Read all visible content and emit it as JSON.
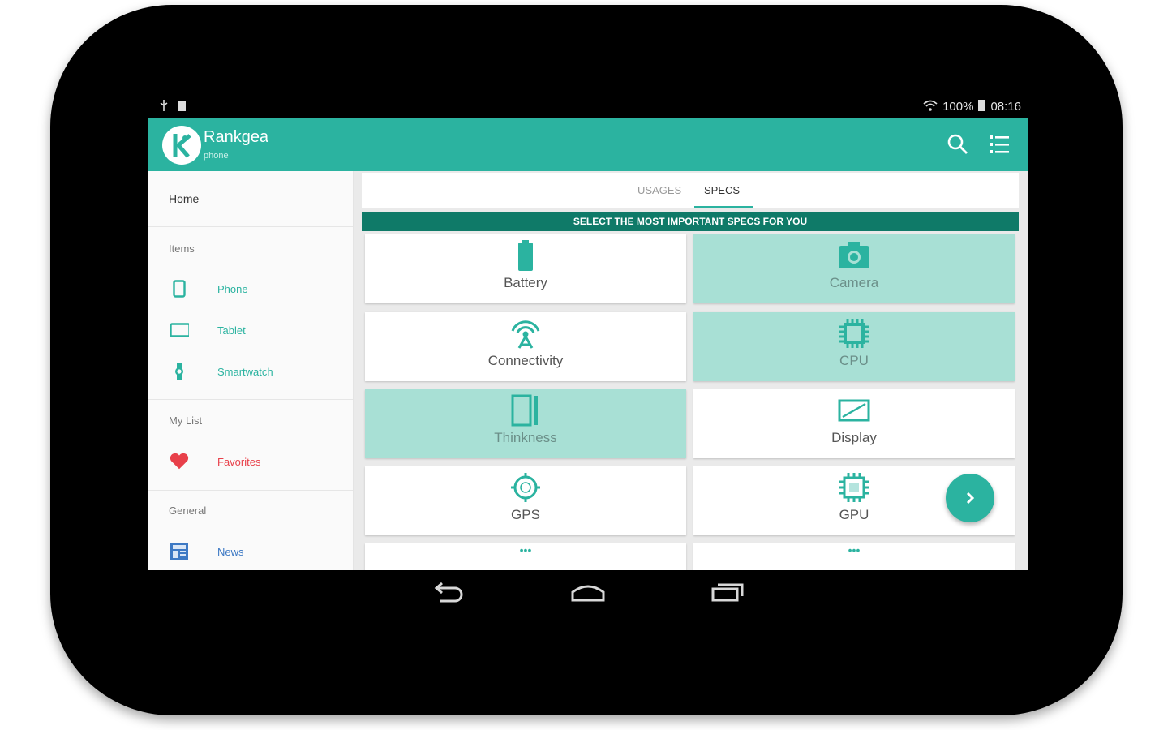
{
  "status": {
    "battery": "100%",
    "time": "08:16"
  },
  "app": {
    "title": "Rankgea",
    "subtitle": "phone"
  },
  "drawer": {
    "home": "Home",
    "sections": {
      "items": "Items",
      "my_list": "My List",
      "general": "General"
    },
    "items": [
      {
        "label": "Phone",
        "icon": "phone-icon"
      },
      {
        "label": "Tablet",
        "icon": "tablet-icon"
      },
      {
        "label": "Smartwatch",
        "icon": "smartwatch-icon"
      }
    ],
    "favorites": {
      "label": "Favorites",
      "icon": "heart-icon",
      "color": "#e8404a"
    },
    "news": {
      "label": "News",
      "icon": "news-icon"
    }
  },
  "tabs": [
    {
      "label": "USAGES",
      "active": false
    },
    {
      "label": "SPECS",
      "active": true
    }
  ],
  "banner": "SELECT THE MOST IMPORTANT SPECS FOR YOU",
  "specs": [
    {
      "label": "Battery",
      "icon": "battery-icon",
      "selected": false
    },
    {
      "label": "Camera",
      "icon": "camera-icon",
      "selected": true
    },
    {
      "label": "Connectivity",
      "icon": "antenna-icon",
      "selected": false
    },
    {
      "label": "CPU",
      "icon": "cpu-icon",
      "selected": true
    },
    {
      "label": "Thinkness",
      "icon": "thickness-icon",
      "selected": true
    },
    {
      "label": "Display",
      "icon": "display-icon",
      "selected": false
    },
    {
      "label": "GPS",
      "icon": "gps-icon",
      "selected": false
    },
    {
      "label": "GPU",
      "icon": "gpu-icon",
      "selected": false
    }
  ],
  "colors": {
    "accent": "#2bb3a0",
    "banner": "#0f7a68",
    "selected": "#a8e0d5"
  }
}
